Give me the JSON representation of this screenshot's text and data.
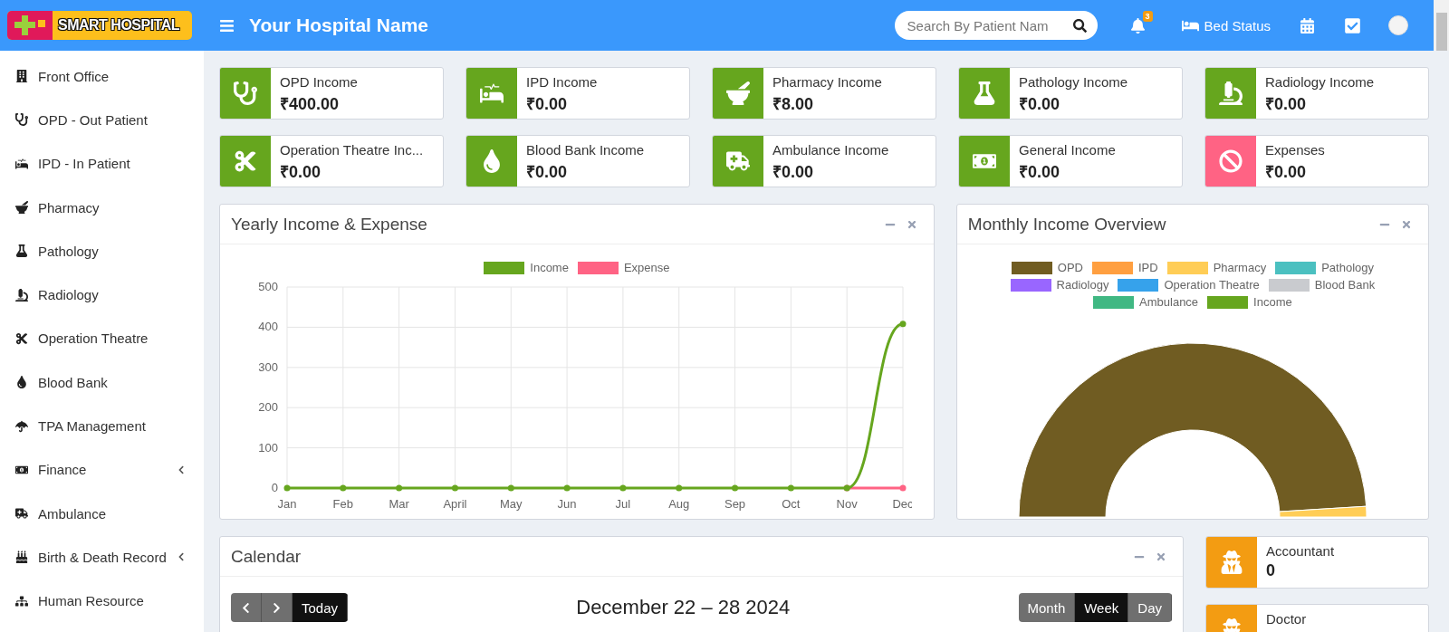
{
  "header": {
    "logo_text": "SMART HOSPITAL",
    "title": "Your Hospital Name",
    "search": {
      "placeholder": "Search By Patient Nam"
    },
    "notification_count": "3",
    "bed_status": "Bed Status"
  },
  "sidebar": {
    "items": [
      {
        "label": "Front Office",
        "has_submenu": false
      },
      {
        "label": "OPD - Out Patient",
        "has_submenu": false
      },
      {
        "label": "IPD - In Patient",
        "has_submenu": false
      },
      {
        "label": "Pharmacy",
        "has_submenu": false
      },
      {
        "label": "Pathology",
        "has_submenu": false
      },
      {
        "label": "Radiology",
        "has_submenu": false
      },
      {
        "label": "Operation Theatre",
        "has_submenu": false
      },
      {
        "label": "Blood Bank",
        "has_submenu": false
      },
      {
        "label": "TPA Management",
        "has_submenu": false
      },
      {
        "label": "Finance",
        "has_submenu": true
      },
      {
        "label": "Ambulance",
        "has_submenu": false
      },
      {
        "label": "Birth & Death Record",
        "has_submenu": true
      },
      {
        "label": "Human Resource",
        "has_submenu": false
      }
    ]
  },
  "income_boxes": [
    {
      "label": "OPD Income",
      "value": "₹400.00",
      "color": "#66a61e"
    },
    {
      "label": "IPD Income",
      "value": "₹0.00",
      "color": "#66a61e"
    },
    {
      "label": "Pharmacy Income",
      "value": "₹8.00",
      "color": "#66a61e"
    },
    {
      "label": "Pathology Income",
      "value": "₹0.00",
      "color": "#66a61e"
    },
    {
      "label": "Radiology Income",
      "value": "₹0.00",
      "color": "#66a61e"
    },
    {
      "label": "Operation Theatre Inc...",
      "value": "₹0.00",
      "color": "#66a61e"
    },
    {
      "label": "Blood Bank Income",
      "value": "₹0.00",
      "color": "#66a61e"
    },
    {
      "label": "Ambulance Income",
      "value": "₹0.00",
      "color": "#66a61e"
    },
    {
      "label": "General Income",
      "value": "₹0.00",
      "color": "#66a61e"
    },
    {
      "label": "Expenses",
      "value": "₹0.00",
      "color": "#ff6384"
    }
  ],
  "yearly_chart": {
    "title": "Yearly Income & Expense",
    "chart_data": {
      "type": "line",
      "categories": [
        "Jan",
        "Feb",
        "Mar",
        "April",
        "May",
        "Jun",
        "Jul",
        "Aug",
        "Sep",
        "Oct",
        "Nov",
        "Dec"
      ],
      "series": [
        {
          "name": "Income",
          "color": "#66a61e",
          "marker": true,
          "values": [
            0,
            0,
            0,
            0,
            0,
            0,
            0,
            0,
            0,
            0,
            0,
            408
          ]
        },
        {
          "name": "Expense",
          "color": "#ff6384",
          "marker": true,
          "values": [
            null,
            null,
            null,
            null,
            null,
            null,
            null,
            null,
            null,
            null,
            0,
            0
          ]
        }
      ],
      "grid": true,
      "ylim": [
        0,
        500
      ],
      "yticks": [
        0,
        100,
        200,
        300,
        400,
        500
      ]
    }
  },
  "monthly_chart": {
    "title": "Monthly Income Overview",
    "chart_data": {
      "type": "donut",
      "categories": [
        "OPD",
        "IPD",
        "Pharmacy",
        "Pathology",
        "Radiology",
        "Operation Theatre",
        "Blood Bank",
        "Ambulance",
        "Income"
      ],
      "series": [
        {
          "colors": [
            "#705c22",
            "#ff9f40",
            "#ffcd56",
            "#4bc0c0",
            "#9966ff",
            "#36a2eb",
            "#c9cbcf",
            "#40b883",
            "#66a61e"
          ],
          "values": [
            98.04,
            0,
            1.96,
            0,
            0,
            0,
            0,
            0,
            0
          ]
        }
      ]
    }
  },
  "calendar": {
    "title": "Calendar",
    "range": "December 22 – 28 2024",
    "today": "Today",
    "views": [
      {
        "label": "Month",
        "selected": false
      },
      {
        "label": "Week",
        "selected": true
      },
      {
        "label": "Day",
        "selected": false
      }
    ]
  },
  "staff": [
    {
      "role": "Accountant",
      "count": "0"
    },
    {
      "role": "Doctor"
    }
  ]
}
